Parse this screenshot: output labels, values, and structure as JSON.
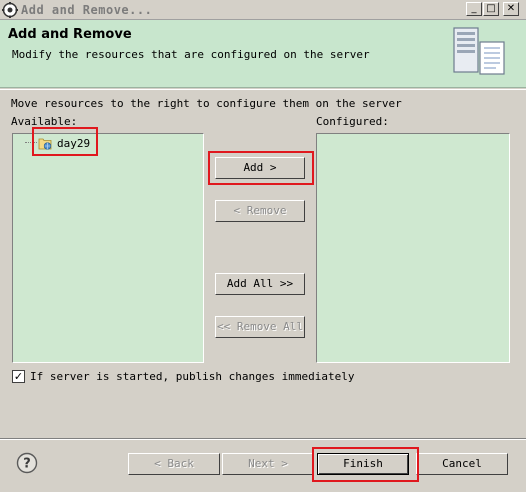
{
  "window": {
    "title": "Add and Remove...",
    "minimize_glyph": "_",
    "maximize_glyph": "□",
    "close_glyph": "✕"
  },
  "header": {
    "title": "Add and Remove",
    "description": "Modify the resources that are configured on the server",
    "banner_icon": "server-icon"
  },
  "main": {
    "instruction": "Move resources to the right to configure them on the server",
    "available_label": "Available:",
    "configured_label": "Configured:",
    "available_items": [
      {
        "label": "day29",
        "icon": "web-project-icon"
      }
    ],
    "configured_items": []
  },
  "buttons": {
    "add": "Add >",
    "remove": "< Remove",
    "add_all": "Add All >>",
    "remove_all": "<< Remove All"
  },
  "options": {
    "publish_label": "If server is started, publish changes immediately",
    "publish_checked": true,
    "check_glyph": "✓"
  },
  "footer": {
    "help_icon": "help-icon",
    "back": "< Back",
    "next": "Next >",
    "finish": "Finish",
    "cancel": "Cancel"
  },
  "colors": {
    "panel_green": "#cfe8d0",
    "header_green": "#c8e6cd",
    "highlight_red": "#e0181e"
  }
}
